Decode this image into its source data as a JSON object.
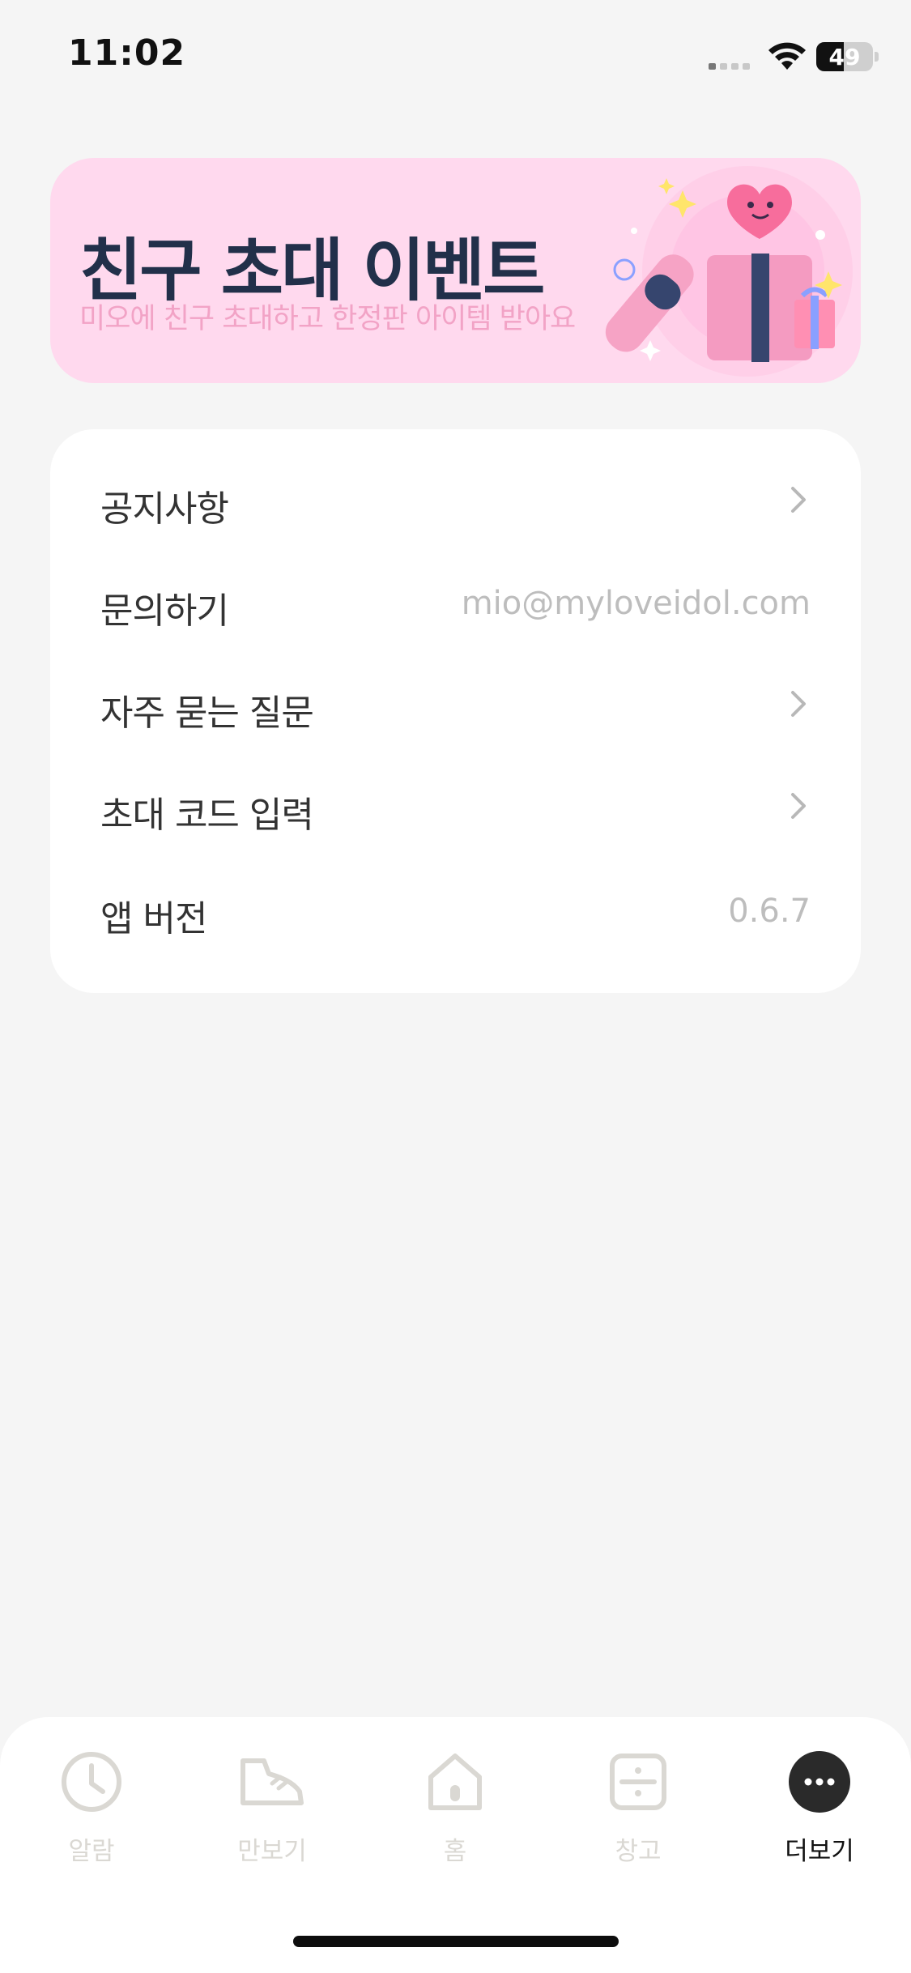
{
  "status_bar": {
    "time": "11:02",
    "battery_level": "49"
  },
  "banner": {
    "title": "친구 초대 이벤트",
    "subtitle": "미오에 친구 초대하고 한정판 아이템 받아요",
    "background_color": "#ffd9ee"
  },
  "menu": {
    "items": [
      {
        "label": "공지사항",
        "value": "",
        "icon": "chevron-right-icon"
      },
      {
        "label": "문의하기",
        "value": "mio@myloveidol.com",
        "icon": ""
      },
      {
        "label": "자주 묻는 질문",
        "value": "",
        "icon": "chevron-right-icon"
      },
      {
        "label": "초대 코드 입력",
        "value": "",
        "icon": "chevron-right-icon"
      },
      {
        "label": "앱 버전",
        "value": "0.6.7",
        "icon": ""
      }
    ]
  },
  "tabbar": {
    "tabs": [
      {
        "label": "알람",
        "icon": "clock-icon",
        "active": false
      },
      {
        "label": "만보기",
        "icon": "sneaker-icon",
        "active": false
      },
      {
        "label": "홈",
        "icon": "house-icon",
        "active": false
      },
      {
        "label": "창고",
        "icon": "box-icon",
        "active": false
      },
      {
        "label": "더보기",
        "icon": "more-icon",
        "active": true
      }
    ],
    "inactive_color": "#dad8d3",
    "active_color": "#111111"
  }
}
